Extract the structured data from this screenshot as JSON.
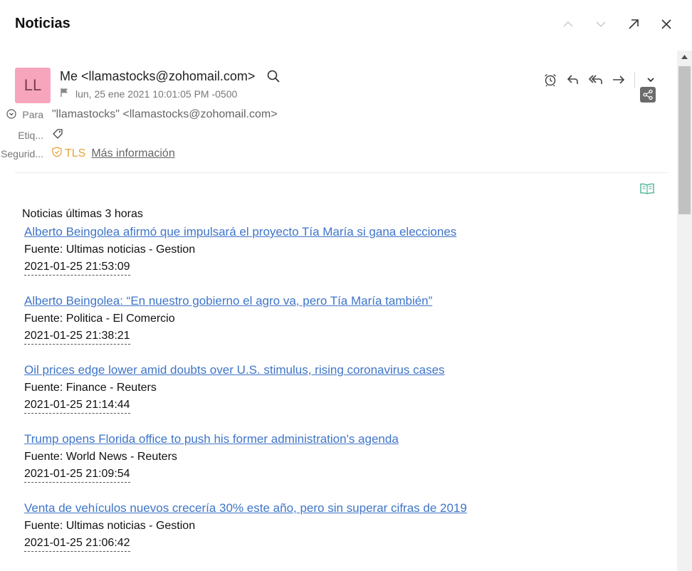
{
  "window": {
    "title": "Noticias",
    "icons": [
      "chevron-up-icon",
      "chevron-down-icon",
      "pop-out-icon",
      "close-icon"
    ]
  },
  "message": {
    "avatar_initials": "LL",
    "avatar_color": "#f6a5bd",
    "sender": "Me <llamastocks@zohomail.com>",
    "date": "lun, 25 ene 2021 10:01:05 PM -0500",
    "to_label": "Para",
    "to_value": "\"llamastocks\" <llamastocks@zohomail.com>",
    "tags_label": "Etiq...",
    "security_label": "Segurid...",
    "security_value": "TLS",
    "security_color": "#e8a13a",
    "more_info": "Más información",
    "action_icons": [
      "alarm-clock-icon",
      "reply-icon",
      "reply-all-icon",
      "forward-icon",
      "more-chevron-icon"
    ]
  },
  "body": {
    "intro": "Noticias últimas 3 horas",
    "link_color": "#3f75c8",
    "items": [
      {
        "title": "Alberto Beingolea afirmó que impulsará el proyecto Tía María si gana elecciones",
        "source": "Fuente: Ultimas noticias - Gestion",
        "time": "2021-01-25 21:53:09"
      },
      {
        "title": "Alberto Beingolea: “En nuestro gobierno el agro va, pero Tía María también”",
        "source": "Fuente: Politica - El Comercio",
        "time": "2021-01-25 21:38:21"
      },
      {
        "title": "Oil prices edge lower amid doubts over U.S. stimulus, rising coronavirus cases",
        "source": "Fuente: Finance - Reuters",
        "time": "2021-01-25 21:14:44"
      },
      {
        "title": "Trump opens Florida office to push his former administration's agenda",
        "source": "Fuente: World News - Reuters",
        "time": "2021-01-25 21:09:54"
      },
      {
        "title": "Venta de vehículos nuevos crecería 30% este año, pero sin superar cifras de 2019",
        "source": "Fuente: Ultimas noticias - Gestion",
        "time": "2021-01-25 21:06:42"
      }
    ]
  }
}
